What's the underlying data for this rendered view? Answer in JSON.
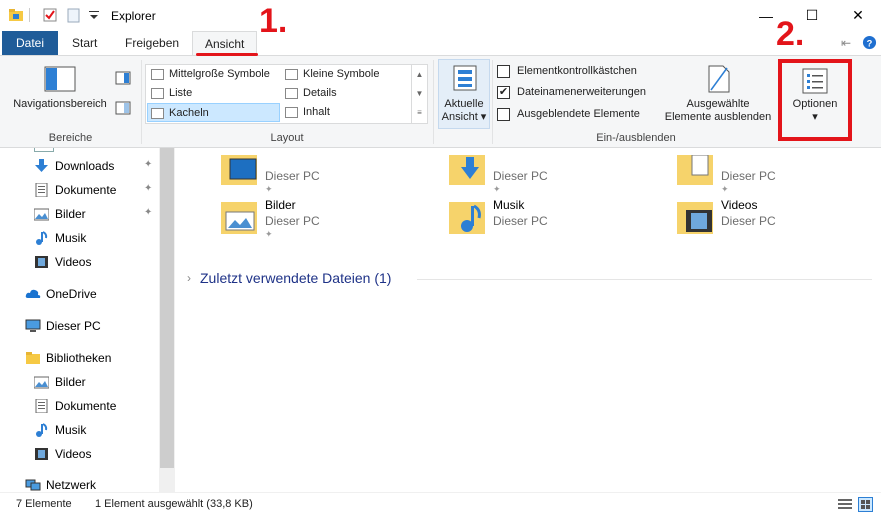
{
  "window": {
    "title": "Explorer",
    "close": "✕",
    "maximize": "☐",
    "minimize": "—"
  },
  "tabs": [
    {
      "label": "Datei"
    },
    {
      "label": "Start"
    },
    {
      "label": "Freigeben"
    },
    {
      "label": "Ansicht"
    }
  ],
  "ribbon": {
    "bereiche": {
      "nav_button": "Navigationsbereich",
      "group_label": "Bereiche"
    },
    "layout": {
      "items": [
        "Mittelgroße Symbole",
        "Kleine Symbole",
        "Liste",
        "Details",
        "Kacheln",
        "Inhalt"
      ],
      "selected": "Kacheln",
      "group_label": "Layout"
    },
    "aktuelle_ansicht": {
      "label_line1": "Aktuelle",
      "label_line2": "Ansicht ▾"
    },
    "einausblenden": {
      "checkboxes": [
        {
          "label": "Elementkontrollkästchen",
          "checked": false
        },
        {
          "label": "Dateinamenerweiterungen",
          "checked": true
        },
        {
          "label": "Ausgeblendete Elemente",
          "checked": false
        }
      ],
      "hide_line1": "Ausgewählte",
      "hide_line2": "Elemente ausblenden",
      "group_label": "Ein-/ausblenden"
    },
    "optionen": {
      "label": "Optionen",
      "arrow": "▾"
    }
  },
  "annotations": {
    "step1": "1.",
    "step2": "2."
  },
  "nav": {
    "quick_items": [
      {
        "label": "Downloads",
        "pinned": true
      },
      {
        "label": "Dokumente",
        "pinned": true
      },
      {
        "label": "Bilder",
        "pinned": true
      },
      {
        "label": "Musik",
        "pinned": false
      },
      {
        "label": "Videos",
        "pinned": false
      }
    ],
    "onedrive": "OneDrive",
    "dieser_pc": "Dieser PC",
    "bibliotheken": "Bibliotheken",
    "lib_items": [
      "Bilder",
      "Dokumente",
      "Musik",
      "Videos"
    ],
    "netzwerk": "Netzwerk"
  },
  "content": {
    "tiles": [
      {
        "name": "",
        "sub": "Dieser PC"
      },
      {
        "name": "",
        "sub": "Dieser PC"
      },
      {
        "name": "",
        "sub": "Dieser PC"
      },
      {
        "name": "Bilder",
        "sub": "Dieser PC"
      },
      {
        "name": "Musik",
        "sub": "Dieser PC"
      },
      {
        "name": "Videos",
        "sub": "Dieser PC"
      }
    ],
    "recent_section": "Zuletzt verwendete Dateien (1)"
  },
  "status": {
    "count": "7 Elemente",
    "selection": "1 Element ausgewählt (33,8 KB)"
  },
  "colors": {
    "accent": "#1f5c99",
    "annotation": "#e3141a",
    "selection": "#cce8ff"
  }
}
